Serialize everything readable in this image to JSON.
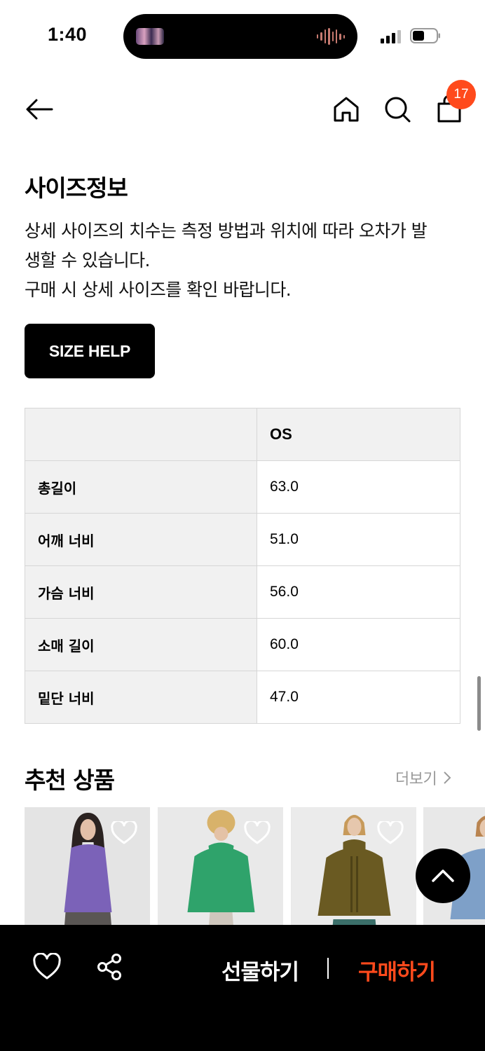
{
  "status_bar": {
    "time": "1:40"
  },
  "header": {
    "cart_count": "17"
  },
  "size_info": {
    "title": "사이즈정보",
    "desc_line1": "상세 사이즈의 치수는 측정 방법과 위치에 따라 오차가 발",
    "desc_line2": "생할 수 있습니다.",
    "desc_line3": "구매 시 상세 사이즈를 확인 바랍니다.",
    "help_button": "SIZE HELP",
    "table": {
      "column": "OS",
      "rows": [
        {
          "label": "총길이",
          "value": "63.0"
        },
        {
          "label": "어깨 너비",
          "value": "51.0"
        },
        {
          "label": "가슴 너비",
          "value": "56.0"
        },
        {
          "label": "소매 길이",
          "value": "60.0"
        },
        {
          "label": "밑단 너비",
          "value": "47.0"
        }
      ]
    }
  },
  "recommend": {
    "title": "추천 상품",
    "more_label": "더보기",
    "products": [
      {
        "sweater_color": "#7b62b8",
        "background": "#e4e4e4"
      },
      {
        "sweater_color": "#2fa36b",
        "background": "#e9e9e9"
      },
      {
        "sweater_color": "#6a5a22",
        "background": "#ebebeb"
      },
      {
        "sweater_color": "#7ea0c8",
        "background": "#e8e8e8"
      }
    ]
  },
  "bottom_bar": {
    "gift_label": "선물하기",
    "buy_label": "구매하기"
  },
  "colors": {
    "accent": "#ff4a1c"
  }
}
